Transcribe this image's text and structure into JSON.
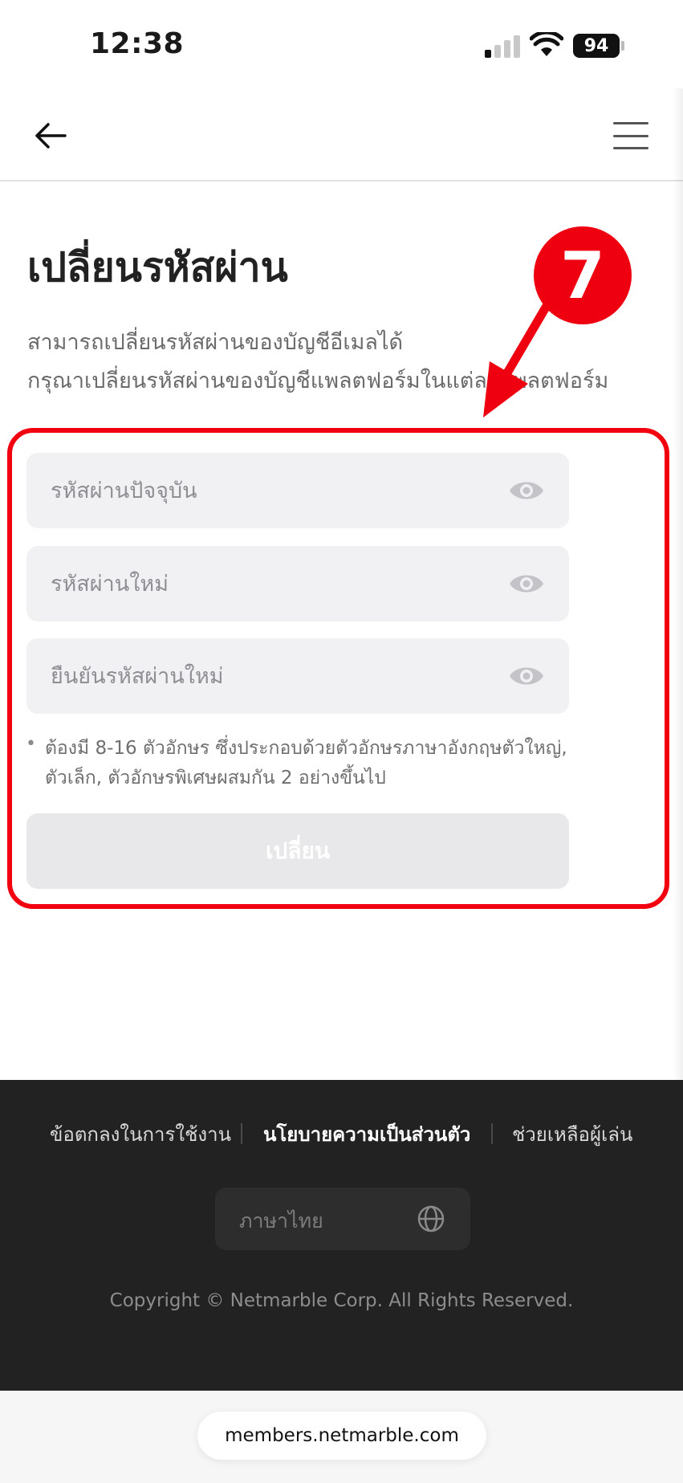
{
  "status_bar": {
    "time": "12:38",
    "battery": "94",
    "signal_bars_on": 1,
    "signal_bars_total": 4
  },
  "nav": {
    "back_icon": "arrow-left-icon",
    "menu_icon": "hamburger-menu-icon"
  },
  "page": {
    "title": "เปลี่ยนรหัสผ่าน",
    "description_line1": "สามารถเปลี่ยนรหัสผ่านของบัญชีอีเมลได้",
    "description_line2": "กรุณาเปลี่ยนรหัสผ่านของบัญชีแพลตฟอร์มในแต่ละแพลตฟอร์ม"
  },
  "form": {
    "current_password_placeholder": "รหัสผ่านปัจจุบัน",
    "new_password_placeholder": "รหัสผ่านใหม่",
    "confirm_password_placeholder": "ยืนยันรหัสผ่านใหม่",
    "eye_icon": "eye-icon",
    "hint_bullet": "•",
    "hint_line1": "ต้องมี 8-16 ตัวอักษร ซึ่งประกอบด้วยตัวอักษรภาษาอังกฤษตัวใหญ่,",
    "hint_line2": "ตัวเล็ก, ตัวอักษรพิเศษผสมกัน 2 อย่างขึ้นไป",
    "submit_label": "เปลี่ยน"
  },
  "annotation": {
    "step_number": "7",
    "color": "#ee0010"
  },
  "footer": {
    "links": [
      "ข้อตกลงในการใช้งาน",
      "นโยบายความเป็นส่วนตัว",
      "ช่วยเหลือผู้เล่น"
    ],
    "language": "ภาษาไทย",
    "globe_icon": "globe-icon",
    "copyright": "Copyright © Netmarble Corp. All Rights Reserved."
  },
  "browser": {
    "url": "members.netmarble.com"
  }
}
